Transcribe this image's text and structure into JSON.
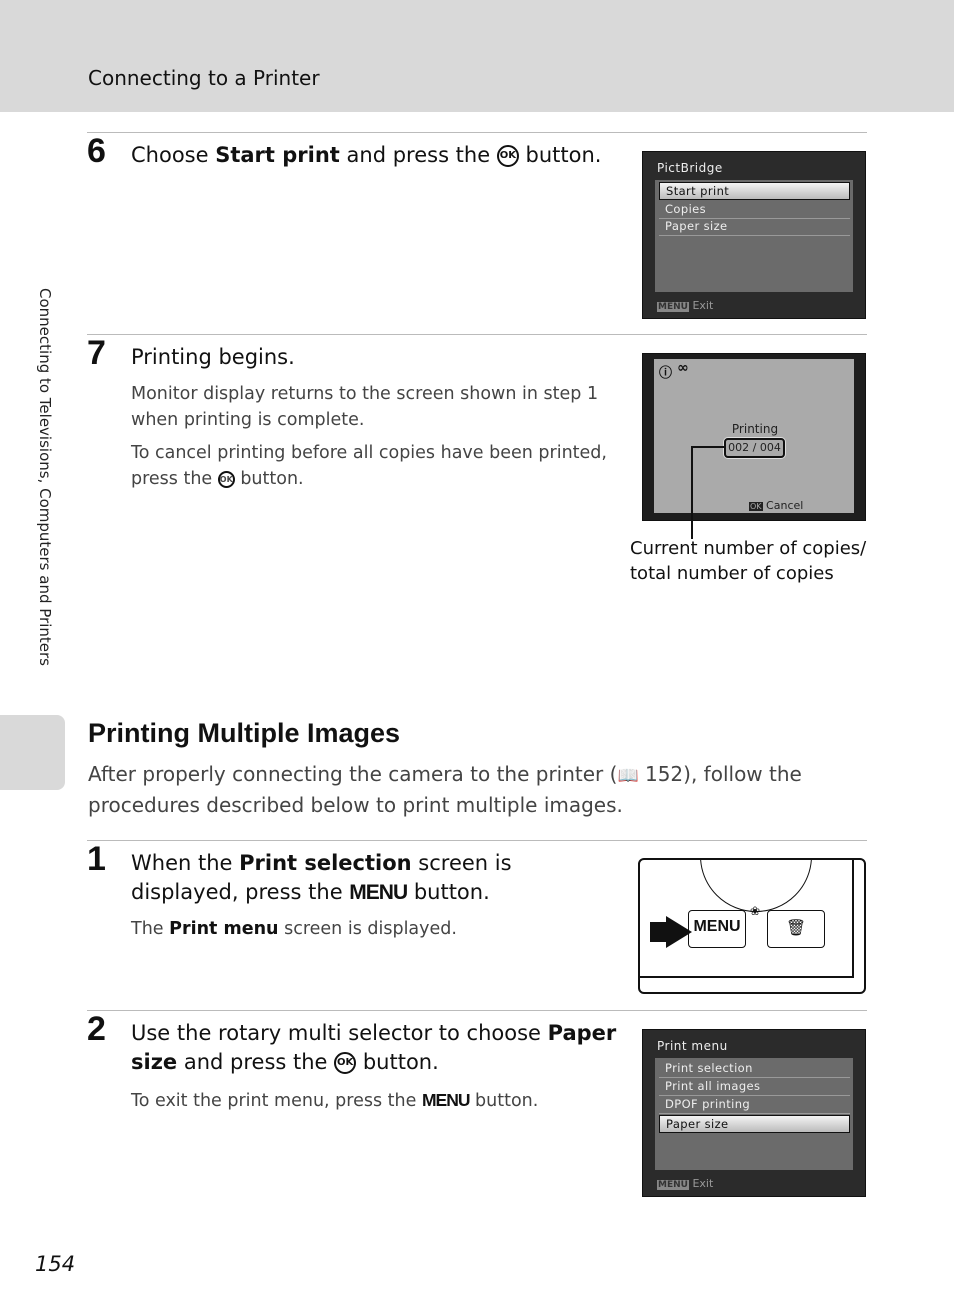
{
  "header": {
    "title": "Connecting to a Printer"
  },
  "side_tab": "Connecting to Televisions, Computers and Printers",
  "step6": {
    "num": "6",
    "pre": "Choose ",
    "bold": "Start print",
    "post": " and press the ",
    "ok": "OK",
    "end": " button.",
    "screen": {
      "title": "PictBridge",
      "items": [
        "Start print",
        "Copies",
        "Paper size"
      ],
      "footer_icon": "MENU",
      "footer": "Exit"
    }
  },
  "step7": {
    "num": "7",
    "title": "Printing begins.",
    "p1": "Monitor display returns to the screen shown in step 1 when printing is complete.",
    "p2_pre": "To cancel printing before all copies have been printed, press the ",
    "ok": "OK",
    "p2_post": " button.",
    "screen": {
      "printing": "Printing",
      "counter": "002 / 004",
      "ok_icon": "OK",
      "cancel": "Cancel"
    },
    "callout": "Current number of copies/ total number of copies"
  },
  "section": {
    "title": "Printing Multiple Images",
    "intro_pre": "After properly connecting the camera to the printer (",
    "ref": "152",
    "intro_post": "), follow the procedures described below to print multiple images."
  },
  "step1": {
    "num": "1",
    "pre": "When the ",
    "bold": "Print selection",
    "mid": " screen is displayed, press the ",
    "menu": "MENU",
    "end": " button.",
    "body_pre": "The ",
    "body_bold": "Print menu",
    "body_post": " screen is displayed.",
    "button_label": "MENU"
  },
  "step2": {
    "num": "2",
    "pre": "Use the rotary multi selector to choose ",
    "bold": "Paper size",
    "mid": " and press the ",
    "ok": "OK",
    "end": " button.",
    "body_pre": "To exit the print menu, press the ",
    "menu": "MENU",
    "body_post": " button.",
    "screen": {
      "title": "Print menu",
      "items": [
        "Print selection",
        "Print all images",
        "DPOF printing",
        "Paper size"
      ],
      "footer_icon": "MENU",
      "footer": "Exit"
    }
  },
  "page_number": "154"
}
